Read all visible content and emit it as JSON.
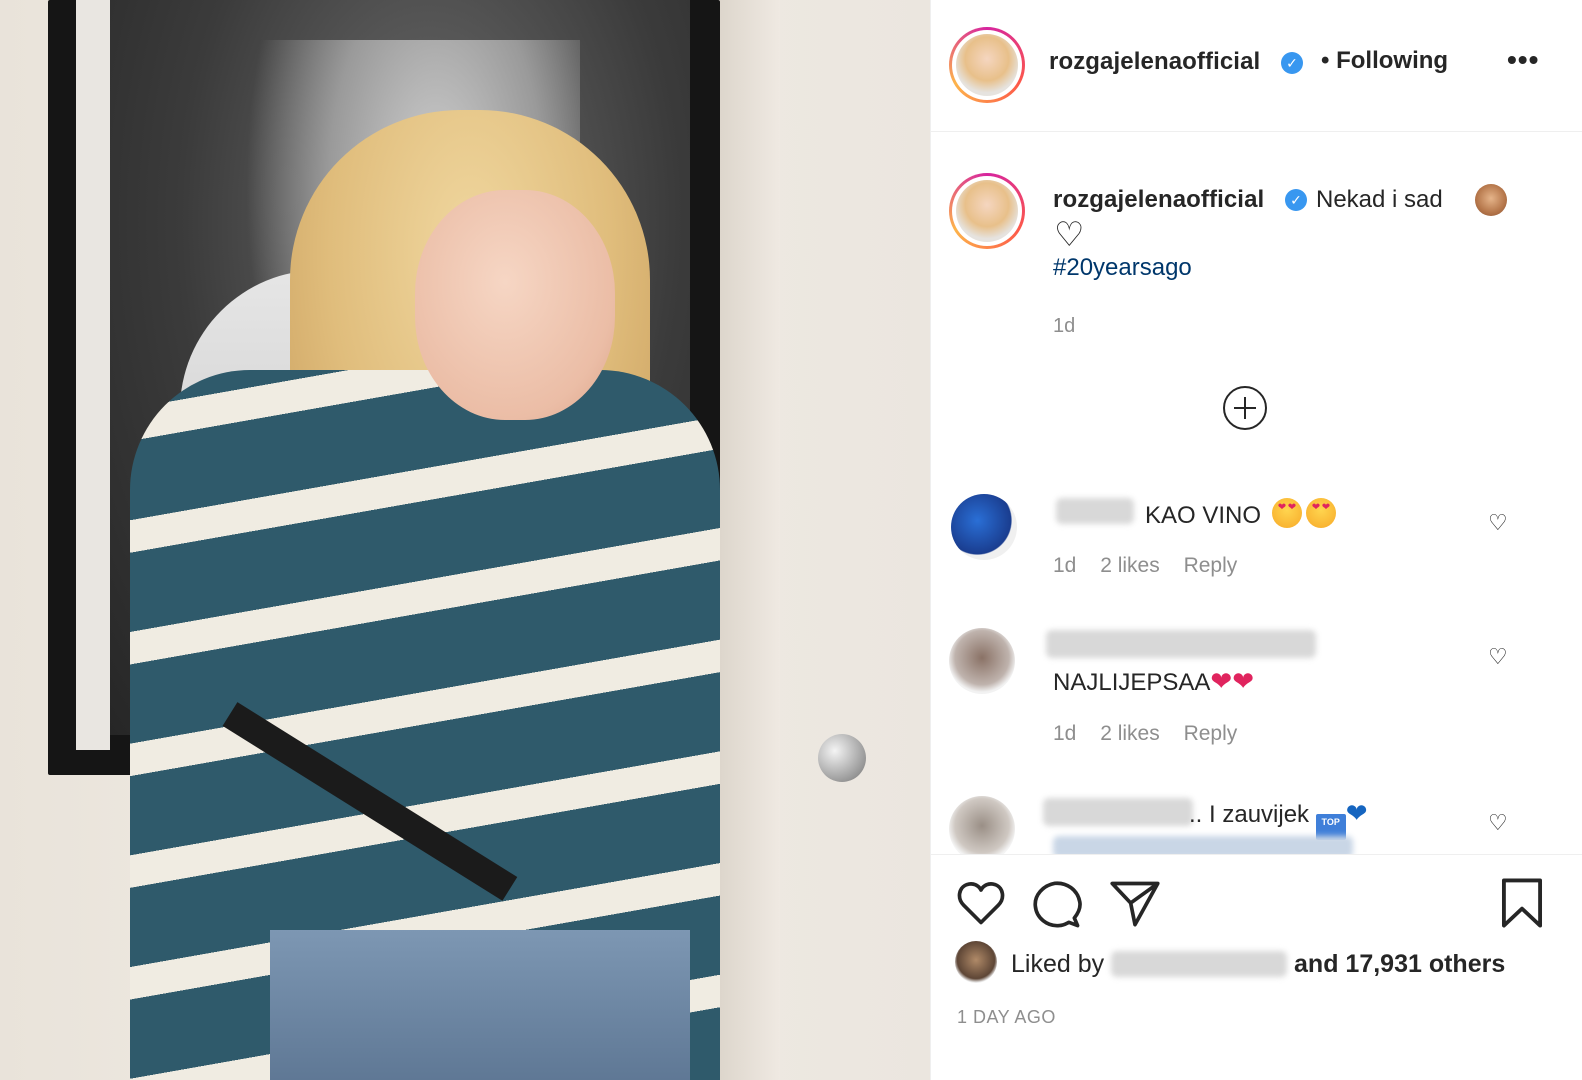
{
  "post": {
    "author": "rozgajelenaofficial",
    "follow_separator": "•",
    "follow_status": "Following",
    "more_glyph": "•••",
    "caption": {
      "text": "Nekad i sad",
      "hashtag": "#20yearsago",
      "time": "1d"
    }
  },
  "comments": [
    {
      "text": "KAO VINO",
      "time": "1d",
      "likes": "2 likes",
      "reply": "Reply"
    },
    {
      "text": "NAJLIJEPSAA",
      "time": "1d",
      "likes": "2 likes",
      "reply": "Reply"
    },
    {
      "text": ".. I zauvijek",
      "badge": "TOP"
    }
  ],
  "footer": {
    "liked_prefix": "Liked by",
    "liked_suffix": "and 17,931 others",
    "date": "1 DAY AGO"
  },
  "icons": {
    "like": "heart-outline-icon",
    "comment": "speech-bubble-icon",
    "share": "paper-plane-icon",
    "save": "bookmark-icon",
    "verified": "verified-badge-icon",
    "load_more": "plus-circle-icon"
  },
  "colors": {
    "verified": "#3897f0",
    "hashtag": "#00376b",
    "muted": "#8e8e8e"
  }
}
